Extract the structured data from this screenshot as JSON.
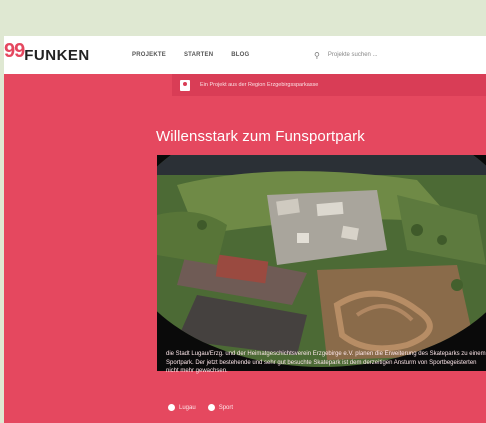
{
  "header": {
    "logo_number": "99",
    "logo_word": "FUNKEN",
    "nav": [
      "PROJEKTE",
      "STARTEN",
      "BLOG"
    ],
    "search_placeholder": "Projekte suchen ..."
  },
  "region_notice": "Ein Projekt aus der Region Erzgebirgssparkasse",
  "project": {
    "title": "Willensstark zum Funsportpark",
    "description": "die Stadt Lugau/Erzg. und der Heimatgeschichtsverein Erzgebirge e.V. planen die Erweiterung des Skateparks zu einem Sportpark. Der jetzt bestehende und sehr gut besuchte Skatepark ist dem derzeitigen Ansturm von Sportbegeisterten nicht mehr gewachsen.",
    "tags": [
      "Lugau",
      "Sport"
    ]
  },
  "colors": {
    "brand": "#e5485f",
    "background": "#dfe8d2"
  }
}
